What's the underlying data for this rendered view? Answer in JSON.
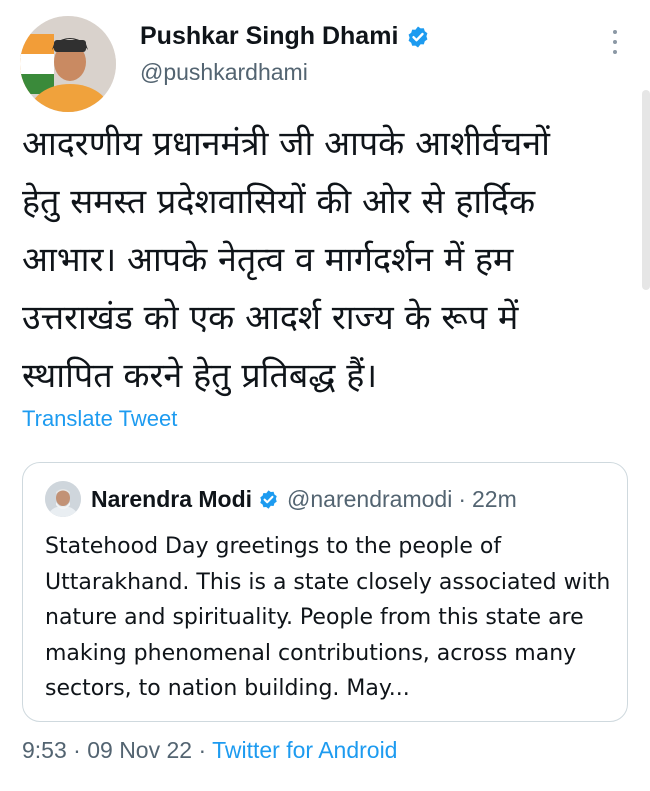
{
  "author": {
    "display_name": "Pushkar Singh Dhami",
    "handle": "@pushkardhami",
    "avatar_icon": "profile-photo",
    "verified_icon": "verified-badge-icon"
  },
  "tweet": {
    "text": "आदरणीय प्रधानमंत्री जी आपके आशीर्वचनों\nहेतु समस्त प्रदेशवासियों की ओर से हार्दिक\nआभार। आपके नेतृत्व व मार्गदर्शन में हम\nउत्तराखंड को एक आदर्श राज्य के रूप में\nस्थापित करने हेतु प्रतिबद्ध हैं।",
    "translate_label": "Translate Tweet"
  },
  "quoted_tweet": {
    "display_name": "Narendra Modi",
    "handle": "@narendramodi",
    "separator": "·",
    "time": "22m",
    "text": "Statehood Day greetings to the people of Uttarakhand. This is a state closely associated with nature and spirituality. People from this state are making phenomenal contributions, across many sectors, to nation building. May..."
  },
  "meta": {
    "time": "9:53",
    "sep1": " · ",
    "date": "09 Nov 22",
    "sep2": " · ",
    "source": "Twitter for Android"
  },
  "colors": {
    "accent": "#1d9bf0",
    "text": "#0f1419",
    "secondary": "#536471",
    "border": "#cfd9de"
  }
}
